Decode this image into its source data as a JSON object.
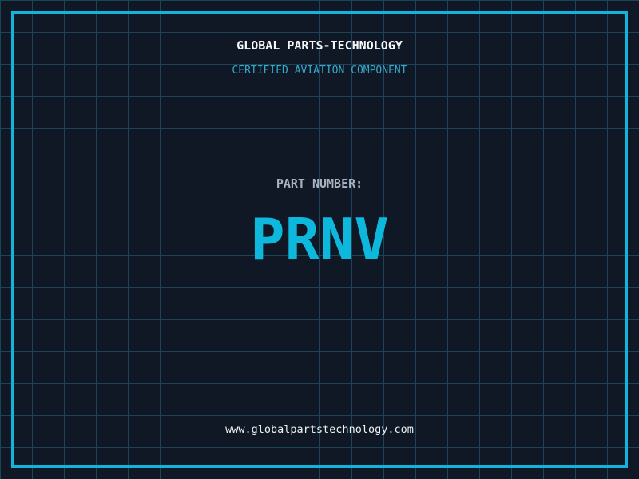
{
  "header": {
    "title": "GLOBAL PARTS-TECHNOLOGY",
    "subtitle": "CERTIFIED AVIATION COMPONENT"
  },
  "part": {
    "label": "PART NUMBER:",
    "number": "PRNV"
  },
  "footer": {
    "website": "www.globalpartstechnology.com"
  },
  "colors": {
    "background": "#101826",
    "grid_line": "#1b4559",
    "frame_border": "#10b4dc",
    "title_text": "#f5f7f8",
    "subtitle_text": "#35a9cc",
    "label_text": "#a9b3bf",
    "part_number_text": "#0db8dc",
    "footer_text": "#eef1f3"
  }
}
